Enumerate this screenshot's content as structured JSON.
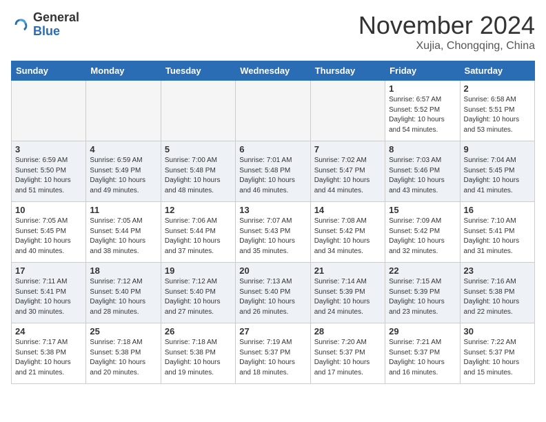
{
  "header": {
    "logo_general": "General",
    "logo_blue": "Blue",
    "month_title": "November 2024",
    "subtitle": "Xujia, Chongqing, China"
  },
  "weekdays": [
    "Sunday",
    "Monday",
    "Tuesday",
    "Wednesday",
    "Thursday",
    "Friday",
    "Saturday"
  ],
  "weeks": [
    [
      {
        "day": "",
        "info": ""
      },
      {
        "day": "",
        "info": ""
      },
      {
        "day": "",
        "info": ""
      },
      {
        "day": "",
        "info": ""
      },
      {
        "day": "",
        "info": ""
      },
      {
        "day": "1",
        "info": "Sunrise: 6:57 AM\nSunset: 5:52 PM\nDaylight: 10 hours\nand 54 minutes."
      },
      {
        "day": "2",
        "info": "Sunrise: 6:58 AM\nSunset: 5:51 PM\nDaylight: 10 hours\nand 53 minutes."
      }
    ],
    [
      {
        "day": "3",
        "info": "Sunrise: 6:59 AM\nSunset: 5:50 PM\nDaylight: 10 hours\nand 51 minutes."
      },
      {
        "day": "4",
        "info": "Sunrise: 6:59 AM\nSunset: 5:49 PM\nDaylight: 10 hours\nand 49 minutes."
      },
      {
        "day": "5",
        "info": "Sunrise: 7:00 AM\nSunset: 5:48 PM\nDaylight: 10 hours\nand 48 minutes."
      },
      {
        "day": "6",
        "info": "Sunrise: 7:01 AM\nSunset: 5:48 PM\nDaylight: 10 hours\nand 46 minutes."
      },
      {
        "day": "7",
        "info": "Sunrise: 7:02 AM\nSunset: 5:47 PM\nDaylight: 10 hours\nand 44 minutes."
      },
      {
        "day": "8",
        "info": "Sunrise: 7:03 AM\nSunset: 5:46 PM\nDaylight: 10 hours\nand 43 minutes."
      },
      {
        "day": "9",
        "info": "Sunrise: 7:04 AM\nSunset: 5:45 PM\nDaylight: 10 hours\nand 41 minutes."
      }
    ],
    [
      {
        "day": "10",
        "info": "Sunrise: 7:05 AM\nSunset: 5:45 PM\nDaylight: 10 hours\nand 40 minutes."
      },
      {
        "day": "11",
        "info": "Sunrise: 7:05 AM\nSunset: 5:44 PM\nDaylight: 10 hours\nand 38 minutes."
      },
      {
        "day": "12",
        "info": "Sunrise: 7:06 AM\nSunset: 5:44 PM\nDaylight: 10 hours\nand 37 minutes."
      },
      {
        "day": "13",
        "info": "Sunrise: 7:07 AM\nSunset: 5:43 PM\nDaylight: 10 hours\nand 35 minutes."
      },
      {
        "day": "14",
        "info": "Sunrise: 7:08 AM\nSunset: 5:42 PM\nDaylight: 10 hours\nand 34 minutes."
      },
      {
        "day": "15",
        "info": "Sunrise: 7:09 AM\nSunset: 5:42 PM\nDaylight: 10 hours\nand 32 minutes."
      },
      {
        "day": "16",
        "info": "Sunrise: 7:10 AM\nSunset: 5:41 PM\nDaylight: 10 hours\nand 31 minutes."
      }
    ],
    [
      {
        "day": "17",
        "info": "Sunrise: 7:11 AM\nSunset: 5:41 PM\nDaylight: 10 hours\nand 30 minutes."
      },
      {
        "day": "18",
        "info": "Sunrise: 7:12 AM\nSunset: 5:40 PM\nDaylight: 10 hours\nand 28 minutes."
      },
      {
        "day": "19",
        "info": "Sunrise: 7:12 AM\nSunset: 5:40 PM\nDaylight: 10 hours\nand 27 minutes."
      },
      {
        "day": "20",
        "info": "Sunrise: 7:13 AM\nSunset: 5:40 PM\nDaylight: 10 hours\nand 26 minutes."
      },
      {
        "day": "21",
        "info": "Sunrise: 7:14 AM\nSunset: 5:39 PM\nDaylight: 10 hours\nand 24 minutes."
      },
      {
        "day": "22",
        "info": "Sunrise: 7:15 AM\nSunset: 5:39 PM\nDaylight: 10 hours\nand 23 minutes."
      },
      {
        "day": "23",
        "info": "Sunrise: 7:16 AM\nSunset: 5:38 PM\nDaylight: 10 hours\nand 22 minutes."
      }
    ],
    [
      {
        "day": "24",
        "info": "Sunrise: 7:17 AM\nSunset: 5:38 PM\nDaylight: 10 hours\nand 21 minutes."
      },
      {
        "day": "25",
        "info": "Sunrise: 7:18 AM\nSunset: 5:38 PM\nDaylight: 10 hours\nand 20 minutes."
      },
      {
        "day": "26",
        "info": "Sunrise: 7:18 AM\nSunset: 5:38 PM\nDaylight: 10 hours\nand 19 minutes."
      },
      {
        "day": "27",
        "info": "Sunrise: 7:19 AM\nSunset: 5:37 PM\nDaylight: 10 hours\nand 18 minutes."
      },
      {
        "day": "28",
        "info": "Sunrise: 7:20 AM\nSunset: 5:37 PM\nDaylight: 10 hours\nand 17 minutes."
      },
      {
        "day": "29",
        "info": "Sunrise: 7:21 AM\nSunset: 5:37 PM\nDaylight: 10 hours\nand 16 minutes."
      },
      {
        "day": "30",
        "info": "Sunrise: 7:22 AM\nSunset: 5:37 PM\nDaylight: 10 hours\nand 15 minutes."
      }
    ]
  ]
}
